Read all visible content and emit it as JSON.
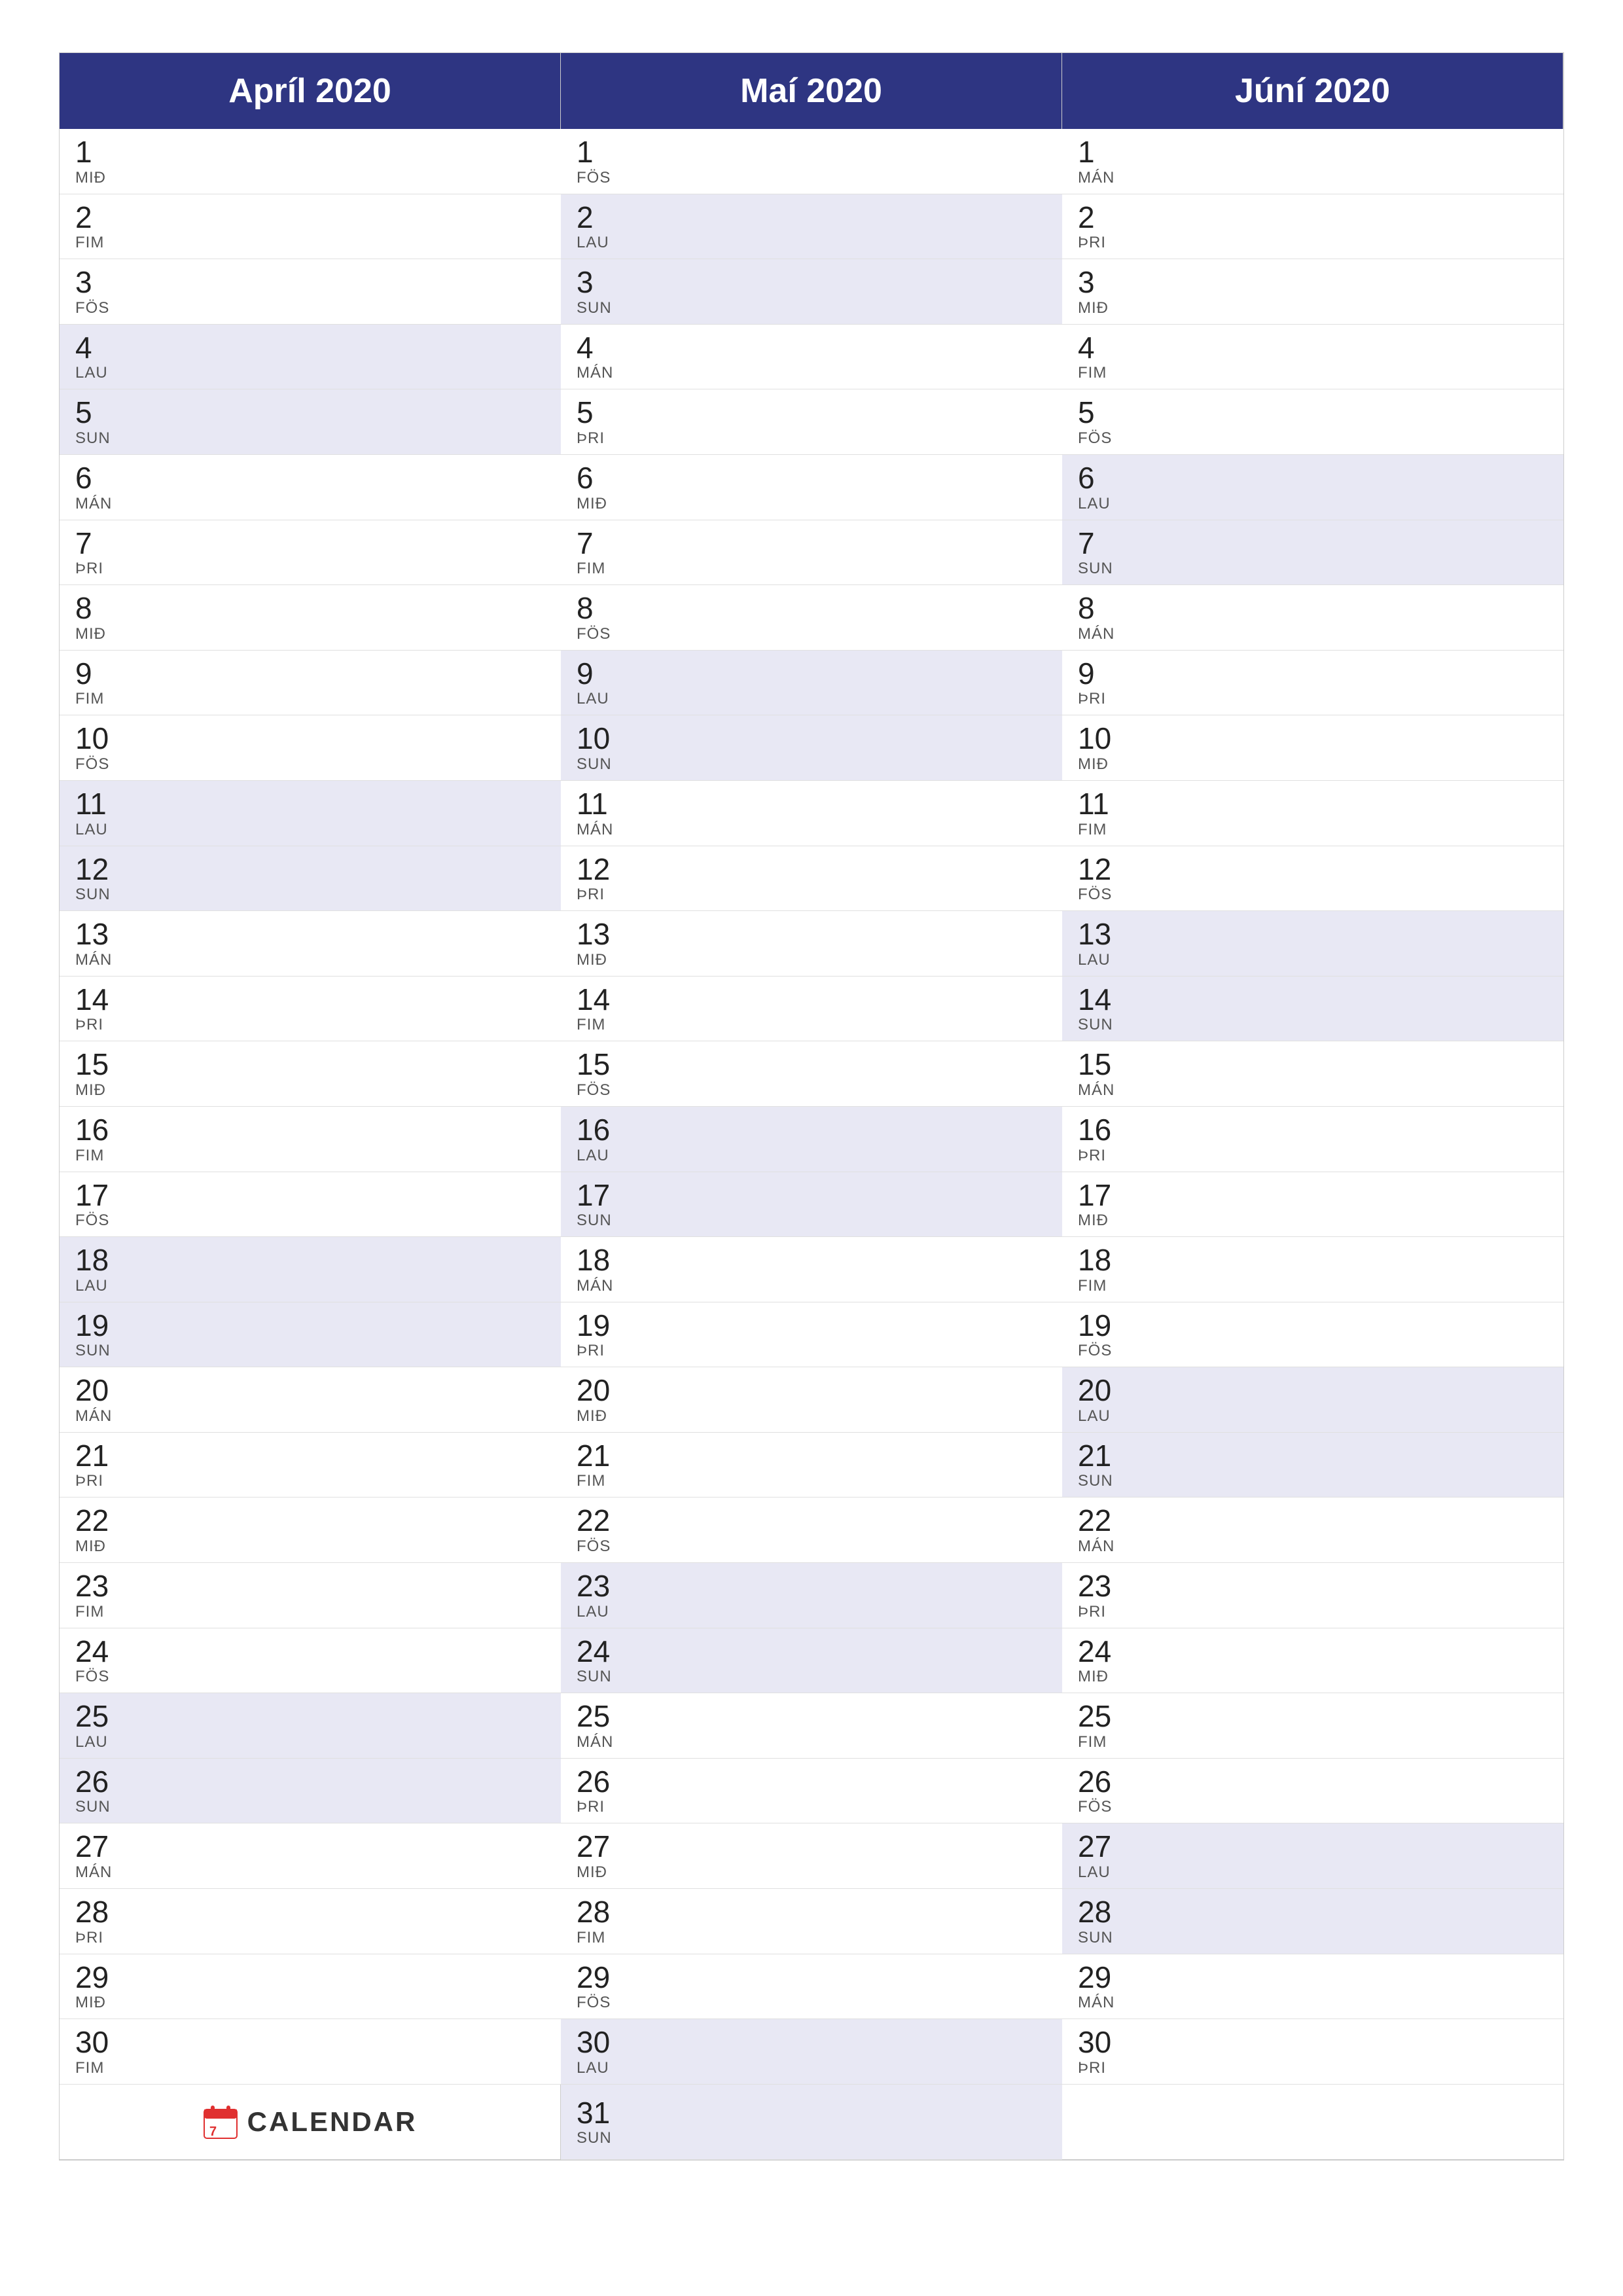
{
  "months": [
    {
      "name": "Apríl 2020",
      "days": [
        {
          "num": 1,
          "label": "MIÐ",
          "weekend": false
        },
        {
          "num": 2,
          "label": "FIM",
          "weekend": false
        },
        {
          "num": 3,
          "label": "FÖS",
          "weekend": false
        },
        {
          "num": 4,
          "label": "LAU",
          "weekend": true
        },
        {
          "num": 5,
          "label": "SUN",
          "weekend": true
        },
        {
          "num": 6,
          "label": "MÁN",
          "weekend": false
        },
        {
          "num": 7,
          "label": "ÞRI",
          "weekend": false
        },
        {
          "num": 8,
          "label": "MIÐ",
          "weekend": false
        },
        {
          "num": 9,
          "label": "FIM",
          "weekend": false
        },
        {
          "num": 10,
          "label": "FÖS",
          "weekend": false
        },
        {
          "num": 11,
          "label": "LAU",
          "weekend": true
        },
        {
          "num": 12,
          "label": "SUN",
          "weekend": true
        },
        {
          "num": 13,
          "label": "MÁN",
          "weekend": false
        },
        {
          "num": 14,
          "label": "ÞRI",
          "weekend": false
        },
        {
          "num": 15,
          "label": "MIÐ",
          "weekend": false
        },
        {
          "num": 16,
          "label": "FIM",
          "weekend": false
        },
        {
          "num": 17,
          "label": "FÖS",
          "weekend": false
        },
        {
          "num": 18,
          "label": "LAU",
          "weekend": true
        },
        {
          "num": 19,
          "label": "SUN",
          "weekend": true
        },
        {
          "num": 20,
          "label": "MÁN",
          "weekend": false
        },
        {
          "num": 21,
          "label": "ÞRI",
          "weekend": false
        },
        {
          "num": 22,
          "label": "MIÐ",
          "weekend": false
        },
        {
          "num": 23,
          "label": "FIM",
          "weekend": false
        },
        {
          "num": 24,
          "label": "FÖS",
          "weekend": false
        },
        {
          "num": 25,
          "label": "LAU",
          "weekend": true
        },
        {
          "num": 26,
          "label": "SUN",
          "weekend": true
        },
        {
          "num": 27,
          "label": "MÁN",
          "weekend": false
        },
        {
          "num": 28,
          "label": "ÞRI",
          "weekend": false
        },
        {
          "num": 29,
          "label": "MIÐ",
          "weekend": false
        },
        {
          "num": 30,
          "label": "FIM",
          "weekend": false
        }
      ]
    },
    {
      "name": "Maí 2020",
      "days": [
        {
          "num": 1,
          "label": "FÖS",
          "weekend": false
        },
        {
          "num": 2,
          "label": "LAU",
          "weekend": true
        },
        {
          "num": 3,
          "label": "SUN",
          "weekend": true
        },
        {
          "num": 4,
          "label": "MÁN",
          "weekend": false
        },
        {
          "num": 5,
          "label": "ÞRI",
          "weekend": false
        },
        {
          "num": 6,
          "label": "MIÐ",
          "weekend": false
        },
        {
          "num": 7,
          "label": "FIM",
          "weekend": false
        },
        {
          "num": 8,
          "label": "FÖS",
          "weekend": false
        },
        {
          "num": 9,
          "label": "LAU",
          "weekend": true
        },
        {
          "num": 10,
          "label": "SUN",
          "weekend": true
        },
        {
          "num": 11,
          "label": "MÁN",
          "weekend": false
        },
        {
          "num": 12,
          "label": "ÞRI",
          "weekend": false
        },
        {
          "num": 13,
          "label": "MIÐ",
          "weekend": false
        },
        {
          "num": 14,
          "label": "FIM",
          "weekend": false
        },
        {
          "num": 15,
          "label": "FÖS",
          "weekend": false
        },
        {
          "num": 16,
          "label": "LAU",
          "weekend": true
        },
        {
          "num": 17,
          "label": "SUN",
          "weekend": true
        },
        {
          "num": 18,
          "label": "MÁN",
          "weekend": false
        },
        {
          "num": 19,
          "label": "ÞRI",
          "weekend": false
        },
        {
          "num": 20,
          "label": "MIÐ",
          "weekend": false
        },
        {
          "num": 21,
          "label": "FIM",
          "weekend": false
        },
        {
          "num": 22,
          "label": "FÖS",
          "weekend": false
        },
        {
          "num": 23,
          "label": "LAU",
          "weekend": true
        },
        {
          "num": 24,
          "label": "SUN",
          "weekend": true
        },
        {
          "num": 25,
          "label": "MÁN",
          "weekend": false
        },
        {
          "num": 26,
          "label": "ÞRI",
          "weekend": false
        },
        {
          "num": 27,
          "label": "MIÐ",
          "weekend": false
        },
        {
          "num": 28,
          "label": "FIM",
          "weekend": false
        },
        {
          "num": 29,
          "label": "FÖS",
          "weekend": false
        },
        {
          "num": 30,
          "label": "LAU",
          "weekend": true
        },
        {
          "num": 31,
          "label": "SUN",
          "weekend": true
        }
      ]
    },
    {
      "name": "Júní 2020",
      "days": [
        {
          "num": 1,
          "label": "MÁN",
          "weekend": false
        },
        {
          "num": 2,
          "label": "ÞRI",
          "weekend": false
        },
        {
          "num": 3,
          "label": "MIÐ",
          "weekend": false
        },
        {
          "num": 4,
          "label": "FIM",
          "weekend": false
        },
        {
          "num": 5,
          "label": "FÖS",
          "weekend": false
        },
        {
          "num": 6,
          "label": "LAU",
          "weekend": true
        },
        {
          "num": 7,
          "label": "SUN",
          "weekend": true
        },
        {
          "num": 8,
          "label": "MÁN",
          "weekend": false
        },
        {
          "num": 9,
          "label": "ÞRI",
          "weekend": false
        },
        {
          "num": 10,
          "label": "MIÐ",
          "weekend": false
        },
        {
          "num": 11,
          "label": "FIM",
          "weekend": false
        },
        {
          "num": 12,
          "label": "FÖS",
          "weekend": false
        },
        {
          "num": 13,
          "label": "LAU",
          "weekend": true
        },
        {
          "num": 14,
          "label": "SUN",
          "weekend": true
        },
        {
          "num": 15,
          "label": "MÁN",
          "weekend": false
        },
        {
          "num": 16,
          "label": "ÞRI",
          "weekend": false
        },
        {
          "num": 17,
          "label": "MIÐ",
          "weekend": false
        },
        {
          "num": 18,
          "label": "FIM",
          "weekend": false
        },
        {
          "num": 19,
          "label": "FÖS",
          "weekend": false
        },
        {
          "num": 20,
          "label": "LAU",
          "weekend": true
        },
        {
          "num": 21,
          "label": "SUN",
          "weekend": true
        },
        {
          "num": 22,
          "label": "MÁN",
          "weekend": false
        },
        {
          "num": 23,
          "label": "ÞRI",
          "weekend": false
        },
        {
          "num": 24,
          "label": "MIÐ",
          "weekend": false
        },
        {
          "num": 25,
          "label": "FIM",
          "weekend": false
        },
        {
          "num": 26,
          "label": "FÖS",
          "weekend": false
        },
        {
          "num": 27,
          "label": "LAU",
          "weekend": true
        },
        {
          "num": 28,
          "label": "SUN",
          "weekend": true
        },
        {
          "num": 29,
          "label": "MÁN",
          "weekend": false
        },
        {
          "num": 30,
          "label": "ÞRI",
          "weekend": false
        }
      ]
    }
  ],
  "logo": {
    "text": "CALENDAR"
  }
}
